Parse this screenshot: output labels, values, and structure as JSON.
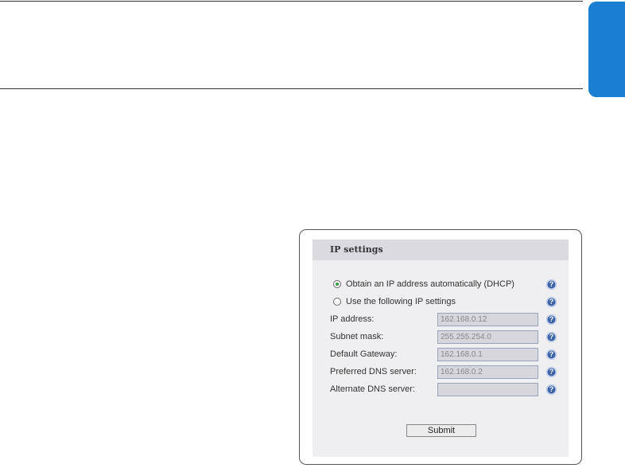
{
  "panel": {
    "title": "IP settings"
  },
  "options": {
    "dhcp_label": "Obtain an IP address automatically (DHCP)",
    "dhcp_selected": true,
    "manual_label": "Use the following IP settings",
    "manual_selected": false
  },
  "fields": [
    {
      "label": "IP address:",
      "value": "162.168.0.12"
    },
    {
      "label": "Subnet mask:",
      "value": "255.255.254.0"
    },
    {
      "label": "Default Gateway:",
      "value": "162.168.0.1"
    },
    {
      "label": "Preferred DNS server:",
      "value": "162.168.0.2"
    },
    {
      "label": "Alternate DNS server:",
      "value": ""
    }
  ],
  "help_glyph": "?",
  "submit_label": "Submit",
  "colors": {
    "side_tab": "#1a7fd1",
    "panel_bg": "#efeff1",
    "header_bg": "#dadae0",
    "help_icon": "#3d63a8",
    "radio_checked": "#2ea043"
  },
  "icons": [
    "help-icon",
    "radio-checked",
    "radio-unchecked"
  ]
}
